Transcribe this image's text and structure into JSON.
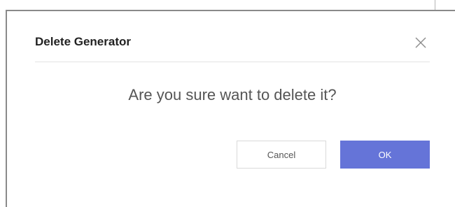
{
  "dialog": {
    "title": "Delete Generator",
    "message": "Are you sure want to delete it?",
    "close_icon": "close-icon",
    "cancel_label": "Cancel",
    "ok_label": "OK"
  },
  "colors": {
    "primary": "#6574d8",
    "text": "#222222",
    "muted_text": "#555555",
    "border": "#d9d9d9"
  }
}
